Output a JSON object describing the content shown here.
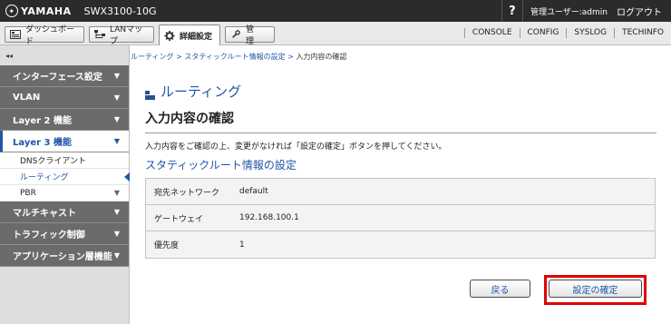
{
  "header": {
    "brand": "YAMAHA",
    "model": "SWX3100-10G",
    "help": "?",
    "user": "管理ユーザー:admin",
    "logout": "ログアウト"
  },
  "tabs": [
    {
      "label": "ダッシュボード",
      "icon": "dashboard-icon"
    },
    {
      "label": "LANマップ",
      "icon": "lanmap-icon"
    },
    {
      "label": "詳細設定",
      "icon": "gear-icon",
      "active": true
    },
    {
      "label": "管　理",
      "icon": "wrench-icon"
    }
  ],
  "util_links": [
    "CONSOLE",
    "CONFIG",
    "SYSLOG",
    "TECHINFO"
  ],
  "sidebar": {
    "collapse": "◂◂",
    "items": [
      {
        "label": "インターフェース設定"
      },
      {
        "label": "VLAN"
      },
      {
        "label": "Layer 2 機能"
      },
      {
        "label": "Layer 3 機能"
      },
      {
        "label": "マルチキャスト"
      },
      {
        "label": "トラフィック制御"
      },
      {
        "label": "アプリケーション層機能"
      }
    ],
    "sub_items": [
      {
        "label": "DNSクライアント"
      },
      {
        "label": "ルーティング"
      },
      {
        "label": "PBR"
      }
    ]
  },
  "breadcrumb": {
    "parts": [
      "ルーティング",
      "スタティックルート情報の設定"
    ],
    "current": "入力内容の確認",
    "sep": " > "
  },
  "page": {
    "title": "ルーティング",
    "subtitle": "入力内容の確認",
    "description": "入力内容をご確認の上、変更がなければ「設定の確定」ボタンを押してください。",
    "section": "スタティックルート情報の設定"
  },
  "table": [
    {
      "key": "宛先ネットワーク",
      "value": "default"
    },
    {
      "key": "ゲートウェイ",
      "value": "192.168.100.1"
    },
    {
      "key": "優先度",
      "value": "1"
    }
  ],
  "buttons": {
    "back": "戻る",
    "confirm": "設定の確定"
  },
  "colors": {
    "accent": "#1f56a8",
    "highlight": "#e00000",
    "topbar": "#2b2b2b"
  }
}
